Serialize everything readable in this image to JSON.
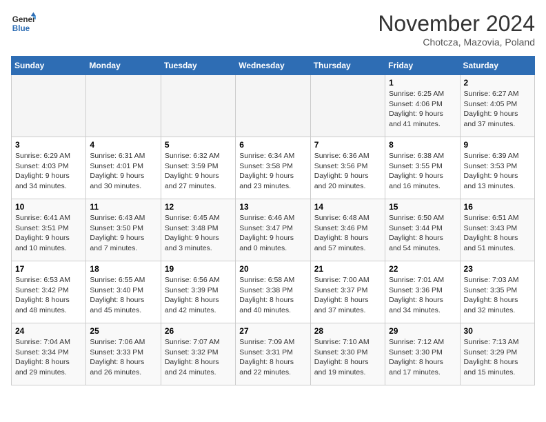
{
  "logo": {
    "line1": "General",
    "line2": "Blue"
  },
  "title": "November 2024",
  "subtitle": "Chotcza, Mazovia, Poland",
  "weekdays": [
    "Sunday",
    "Monday",
    "Tuesday",
    "Wednesday",
    "Thursday",
    "Friday",
    "Saturday"
  ],
  "weeks": [
    [
      {
        "day": "",
        "info": ""
      },
      {
        "day": "",
        "info": ""
      },
      {
        "day": "",
        "info": ""
      },
      {
        "day": "",
        "info": ""
      },
      {
        "day": "",
        "info": ""
      },
      {
        "day": "1",
        "info": "Sunrise: 6:25 AM\nSunset: 4:06 PM\nDaylight: 9 hours\nand 41 minutes."
      },
      {
        "day": "2",
        "info": "Sunrise: 6:27 AM\nSunset: 4:05 PM\nDaylight: 9 hours\nand 37 minutes."
      }
    ],
    [
      {
        "day": "3",
        "info": "Sunrise: 6:29 AM\nSunset: 4:03 PM\nDaylight: 9 hours\nand 34 minutes."
      },
      {
        "day": "4",
        "info": "Sunrise: 6:31 AM\nSunset: 4:01 PM\nDaylight: 9 hours\nand 30 minutes."
      },
      {
        "day": "5",
        "info": "Sunrise: 6:32 AM\nSunset: 3:59 PM\nDaylight: 9 hours\nand 27 minutes."
      },
      {
        "day": "6",
        "info": "Sunrise: 6:34 AM\nSunset: 3:58 PM\nDaylight: 9 hours\nand 23 minutes."
      },
      {
        "day": "7",
        "info": "Sunrise: 6:36 AM\nSunset: 3:56 PM\nDaylight: 9 hours\nand 20 minutes."
      },
      {
        "day": "8",
        "info": "Sunrise: 6:38 AM\nSunset: 3:55 PM\nDaylight: 9 hours\nand 16 minutes."
      },
      {
        "day": "9",
        "info": "Sunrise: 6:39 AM\nSunset: 3:53 PM\nDaylight: 9 hours\nand 13 minutes."
      }
    ],
    [
      {
        "day": "10",
        "info": "Sunrise: 6:41 AM\nSunset: 3:51 PM\nDaylight: 9 hours\nand 10 minutes."
      },
      {
        "day": "11",
        "info": "Sunrise: 6:43 AM\nSunset: 3:50 PM\nDaylight: 9 hours\nand 7 minutes."
      },
      {
        "day": "12",
        "info": "Sunrise: 6:45 AM\nSunset: 3:48 PM\nDaylight: 9 hours\nand 3 minutes."
      },
      {
        "day": "13",
        "info": "Sunrise: 6:46 AM\nSunset: 3:47 PM\nDaylight: 9 hours\nand 0 minutes."
      },
      {
        "day": "14",
        "info": "Sunrise: 6:48 AM\nSunset: 3:46 PM\nDaylight: 8 hours\nand 57 minutes."
      },
      {
        "day": "15",
        "info": "Sunrise: 6:50 AM\nSunset: 3:44 PM\nDaylight: 8 hours\nand 54 minutes."
      },
      {
        "day": "16",
        "info": "Sunrise: 6:51 AM\nSunset: 3:43 PM\nDaylight: 8 hours\nand 51 minutes."
      }
    ],
    [
      {
        "day": "17",
        "info": "Sunrise: 6:53 AM\nSunset: 3:42 PM\nDaylight: 8 hours\nand 48 minutes."
      },
      {
        "day": "18",
        "info": "Sunrise: 6:55 AM\nSunset: 3:40 PM\nDaylight: 8 hours\nand 45 minutes."
      },
      {
        "day": "19",
        "info": "Sunrise: 6:56 AM\nSunset: 3:39 PM\nDaylight: 8 hours\nand 42 minutes."
      },
      {
        "day": "20",
        "info": "Sunrise: 6:58 AM\nSunset: 3:38 PM\nDaylight: 8 hours\nand 40 minutes."
      },
      {
        "day": "21",
        "info": "Sunrise: 7:00 AM\nSunset: 3:37 PM\nDaylight: 8 hours\nand 37 minutes."
      },
      {
        "day": "22",
        "info": "Sunrise: 7:01 AM\nSunset: 3:36 PM\nDaylight: 8 hours\nand 34 minutes."
      },
      {
        "day": "23",
        "info": "Sunrise: 7:03 AM\nSunset: 3:35 PM\nDaylight: 8 hours\nand 32 minutes."
      }
    ],
    [
      {
        "day": "24",
        "info": "Sunrise: 7:04 AM\nSunset: 3:34 PM\nDaylight: 8 hours\nand 29 minutes."
      },
      {
        "day": "25",
        "info": "Sunrise: 7:06 AM\nSunset: 3:33 PM\nDaylight: 8 hours\nand 26 minutes."
      },
      {
        "day": "26",
        "info": "Sunrise: 7:07 AM\nSunset: 3:32 PM\nDaylight: 8 hours\nand 24 minutes."
      },
      {
        "day": "27",
        "info": "Sunrise: 7:09 AM\nSunset: 3:31 PM\nDaylight: 8 hours\nand 22 minutes."
      },
      {
        "day": "28",
        "info": "Sunrise: 7:10 AM\nSunset: 3:30 PM\nDaylight: 8 hours\nand 19 minutes."
      },
      {
        "day": "29",
        "info": "Sunrise: 7:12 AM\nSunset: 3:30 PM\nDaylight: 8 hours\nand 17 minutes."
      },
      {
        "day": "30",
        "info": "Sunrise: 7:13 AM\nSunset: 3:29 PM\nDaylight: 8 hours\nand 15 minutes."
      }
    ]
  ]
}
